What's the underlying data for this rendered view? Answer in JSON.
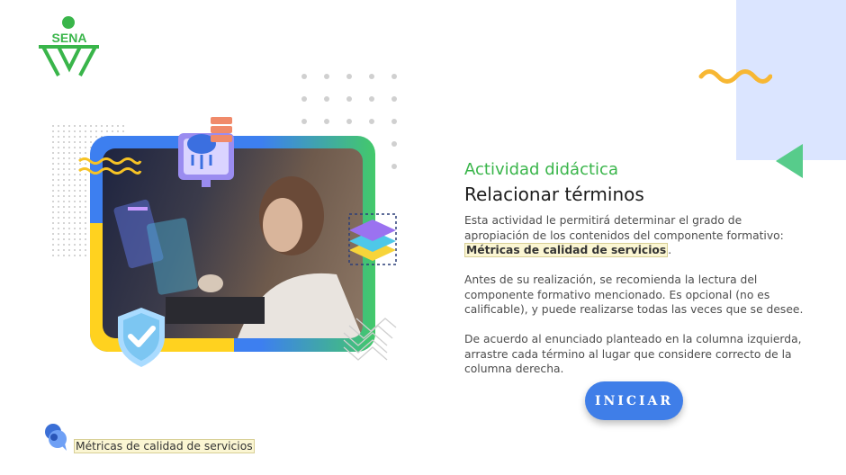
{
  "brand": {
    "logo_text": "SENA",
    "color": "#39b54a"
  },
  "activity": {
    "eyebrow": "Actividad didáctica",
    "title": "Relacionar términos",
    "p1_before": "Esta actividad le permitirá determinar el grado de apropiación de los contenidos del componente formativo: ",
    "p1_highlight": "Métricas de calidad de servicios",
    "p1_after": ".",
    "p2": "Antes de su realización, se recomienda la lectura del componente formativo mencionado.  Es opcional (no es calificable), y puede realizarse todas las veces que se desee.",
    "p3": "De acuerdo al enunciado planteado en la columna izquierda, arrastre cada término al lugar que considere correcto de la columna derecha.",
    "start_label": "INICIAR"
  },
  "footer": {
    "component_label": "Métricas de calidad de servicios"
  },
  "colors": {
    "accent_green": "#39b54a",
    "button_blue": "#3f7ee8",
    "panel_blue": "#dbe5ff",
    "triangle_green": "#57cc8b",
    "wave_yellow": "#f7b733",
    "highlight_bg": "#fbf6d3"
  },
  "icons": {
    "logo": "sena-logo",
    "cloud": "cloud-server-icon",
    "layers": "layers-icon",
    "shield": "shield-check-icon",
    "chat": "chat-bubbles-icon"
  }
}
